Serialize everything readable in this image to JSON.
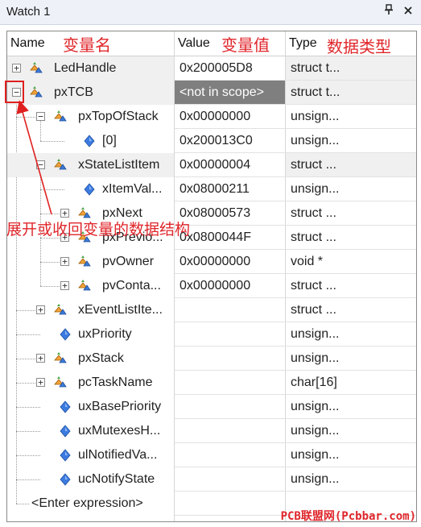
{
  "window": {
    "title": "Watch 1",
    "pin_icon": "pin-icon",
    "close_icon": "close-icon"
  },
  "columns": {
    "name": "Name",
    "value": "Value",
    "type": "Type"
  },
  "annotations": {
    "name_cn": "变量名",
    "value_cn": "变量值",
    "type_cn": "数据类型",
    "expand_cn": "展开或收回变量的数据结构",
    "color": "#e0262b"
  },
  "rows": [
    {
      "name": "LedHandle",
      "value": "0x200005D8",
      "type": "struct t...",
      "indent": 0,
      "icon": "struct-icon",
      "expander": "+",
      "selected": true
    },
    {
      "name": "pxTCB",
      "value": "<not in scope>",
      "type": "struct t...",
      "indent": 0,
      "icon": "struct-icon",
      "expander": "−",
      "selected": true,
      "value_grey": true
    },
    {
      "name": "pxTopOfStack",
      "value": "0x00000000",
      "type": "unsign...",
      "indent": 1,
      "icon": "struct-icon",
      "expander": "−"
    },
    {
      "name": "[0]",
      "value": "0x200013C0",
      "type": "unsign...",
      "indent": 2,
      "icon": "diamond-icon",
      "expander": ""
    },
    {
      "name": "xStateListItem",
      "value": "0x00000004",
      "type": "struct ...",
      "indent": 1,
      "icon": "struct-icon",
      "expander": "−",
      "selected": true
    },
    {
      "name": "xItemVal...",
      "value": "0x08000211",
      "type": "unsign...",
      "indent": 2,
      "icon": "diamond-icon",
      "expander": ""
    },
    {
      "name": "pxNext",
      "value": "0x08000573",
      "type": "struct ...",
      "indent": 2,
      "icon": "struct-icon",
      "expander": "+"
    },
    {
      "name": "pxPrevio...",
      "value": "0x0800044F",
      "type": "struct ...",
      "indent": 2,
      "icon": "struct-icon",
      "expander": "+"
    },
    {
      "name": "pvOwner",
      "value": "0x00000000",
      "type": "void *",
      "indent": 2,
      "icon": "struct-icon",
      "expander": "+"
    },
    {
      "name": "pvConta...",
      "value": "0x00000000",
      "type": "struct ...",
      "indent": 2,
      "icon": "struct-icon",
      "expander": "+"
    },
    {
      "name": "xEventListIte...",
      "value": "",
      "type": "struct ...",
      "indent": 1,
      "icon": "struct-icon",
      "expander": "+"
    },
    {
      "name": "uxPriority",
      "value": "",
      "type": "unsign...",
      "indent": 1,
      "icon": "diamond-icon",
      "expander": ""
    },
    {
      "name": "pxStack",
      "value": "",
      "type": "unsign...",
      "indent": 1,
      "icon": "struct-icon",
      "expander": "+"
    },
    {
      "name": "pcTaskName",
      "value": "",
      "type": "char[16]",
      "indent": 1,
      "icon": "struct-icon",
      "expander": "+"
    },
    {
      "name": "uxBasePriority",
      "value": "",
      "type": "unsign...",
      "indent": 1,
      "icon": "diamond-icon",
      "expander": ""
    },
    {
      "name": "uxMutexesH...",
      "value": "",
      "type": "unsign...",
      "indent": 1,
      "icon": "diamond-icon",
      "expander": ""
    },
    {
      "name": "ulNotifiedVa...",
      "value": "",
      "type": "unsign...",
      "indent": 1,
      "icon": "diamond-icon",
      "expander": ""
    },
    {
      "name": "ucNotifyState",
      "value": "",
      "type": "unsign...",
      "indent": 1,
      "icon": "diamond-icon",
      "expander": ""
    }
  ],
  "enter_expression": "<Enter expression>",
  "watermark": "PCB联盟网(Pcbbar.com)"
}
